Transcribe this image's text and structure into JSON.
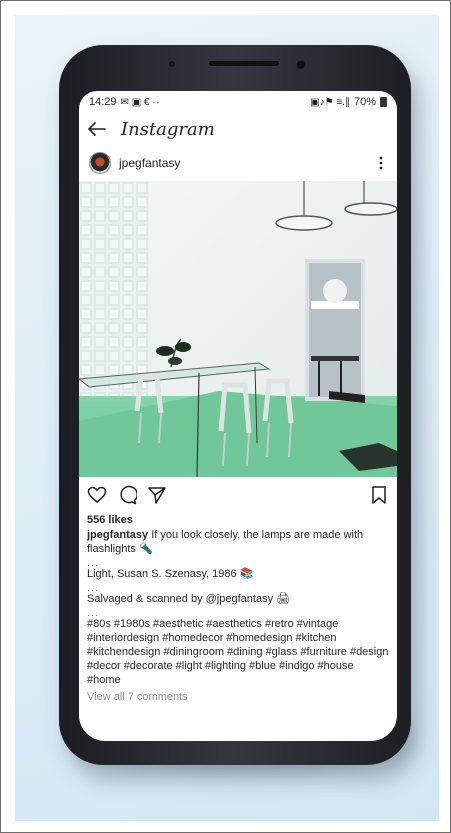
{
  "status_bar": {
    "time": "14:29",
    "left_icons": "✉ ▣ € ··",
    "right_icons": "▣♪⚑ ≡.∥",
    "battery": "70%"
  },
  "app": {
    "title": "Instagram"
  },
  "post": {
    "username": "jpegfantasy",
    "likes": "556 likes",
    "caption_handle": "jpegfantasy",
    "caption_text": " If you look closely, the lamps are made with flashlights 🔦",
    "separator_1": "...",
    "line_2": "Light, Susan S. Szenasy, 1986 📚",
    "separator_2": "...",
    "line_3": "Salvaged & scanned by @jpegfantasy 🖨",
    "separator_3": "...",
    "hashtags": "#80s #1980s #aesthetic #aesthetics #retro #vintage #interiordesign #homedecor #homedesign #kitchen #kitchendesign #diningroom #dining #glass #furniture #design #decor #decorate #light #lighting #blue #indigo #house #home",
    "view_comments": "View all 7 comments"
  },
  "icons": {
    "back": "arrow-left-icon",
    "more": "more-vertical-icon",
    "like": "heart-icon",
    "comment": "comment-icon",
    "share": "send-icon",
    "save": "bookmark-icon"
  },
  "colors": {
    "background": "#dfeef7",
    "phone_body": "#2a2c32",
    "screen": "#ffffff",
    "floor_green": "#6fc79a",
    "text": "#262626"
  }
}
